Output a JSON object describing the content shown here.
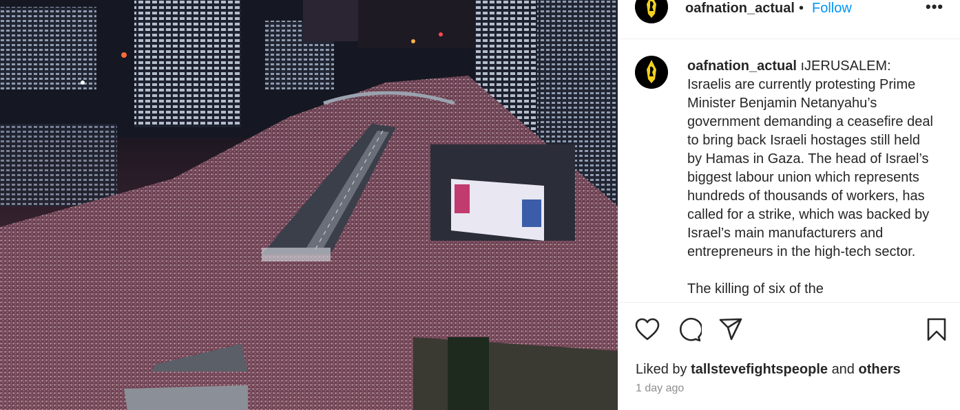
{
  "post": {
    "image_alt": "Aerial night view of a massive crowd of protesters filling a highway between city towers",
    "author": {
      "username": "oafnation_actual",
      "separator": "•",
      "follow_label": "Follow",
      "more_label": "•••",
      "avatar_icon": "knight-logo-icon"
    },
    "caption": {
      "username": "oafnation_actual",
      "text": "ıJERUSALEM: Israelis are currently protesting Prime Minister Benjamin Netanyahu’s government demanding a ceasefire deal to bring back Israeli hostages still held by Hamas in Gaza. The head of Israel’s biggest labour union which represents hundreds of thousands of workers, has called for a strike, which was backed by Israel’s main manufacturers and entrepreneurs in the high-tech sector.",
      "next_line_partial": "The killing of six of the"
    },
    "actions": {
      "like_icon": "heart-icon",
      "comment_icon": "comment-icon",
      "share_icon": "share-icon",
      "save_icon": "bookmark-icon"
    },
    "likes": {
      "prefix": "Liked by",
      "liker": "tallstevefightspeople",
      "conjunction": "and",
      "others": "others"
    },
    "timestamp": "1 day ago"
  },
  "colors": {
    "follow_blue": "#0095f6",
    "text": "#262626",
    "muted": "#8e8e8e",
    "avatar_bg": "#000000",
    "avatar_accent": "#f3d21b"
  }
}
